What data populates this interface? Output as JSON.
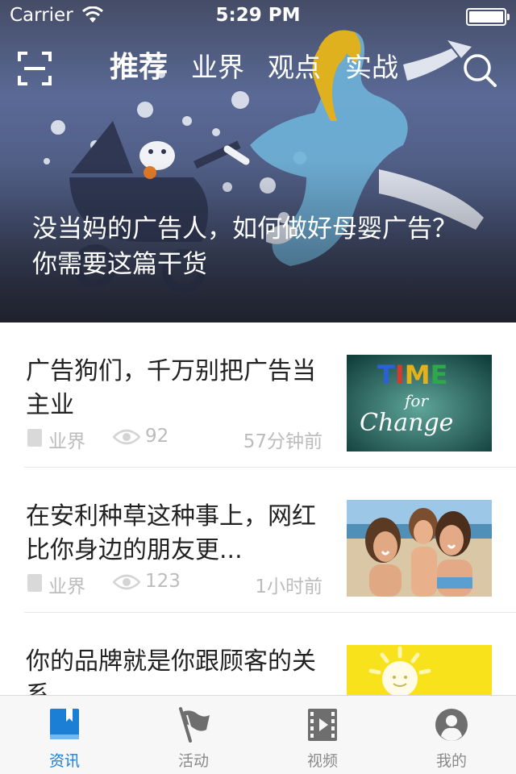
{
  "status_bar": {
    "carrier": "Carrier",
    "time": "5:29 PM"
  },
  "nav": {
    "tabs": [
      {
        "label": "推荐",
        "active": true
      },
      {
        "label": "业界",
        "active": false
      },
      {
        "label": "观点",
        "active": false
      },
      {
        "label": "实战",
        "active": false
      }
    ],
    "left_icon": "scan-icon",
    "right_icon": "search-icon"
  },
  "hero": {
    "title": "没当妈的广告人，如何做好母婴广告？你需要这篇干货"
  },
  "news": [
    {
      "title": "广告狗们，千万别把广告当主业",
      "category": "业界",
      "views": "92",
      "time": "57分钟前"
    },
    {
      "title": "在安利种草这种事上，网红比你身边的朋友更...",
      "category": "业界",
      "views": "123",
      "time": "1小时前"
    },
    {
      "title": "你的品牌就是你跟顾客的关系",
      "category": "",
      "views": "",
      "time": ""
    }
  ],
  "thumb1": {
    "word1": "TIME",
    "word2": "for",
    "word3": "Change"
  },
  "tab_bar": {
    "items": [
      {
        "label": "资讯",
        "icon": "book-icon",
        "active": true
      },
      {
        "label": "活动",
        "icon": "flag-icon",
        "active": false
      },
      {
        "label": "视频",
        "icon": "film-icon",
        "active": false
      },
      {
        "label": "我的",
        "icon": "user-icon",
        "active": false
      }
    ]
  },
  "colors": {
    "accent": "#1b7fd6",
    "meta": "#bcbcbc",
    "text": "#222222"
  }
}
